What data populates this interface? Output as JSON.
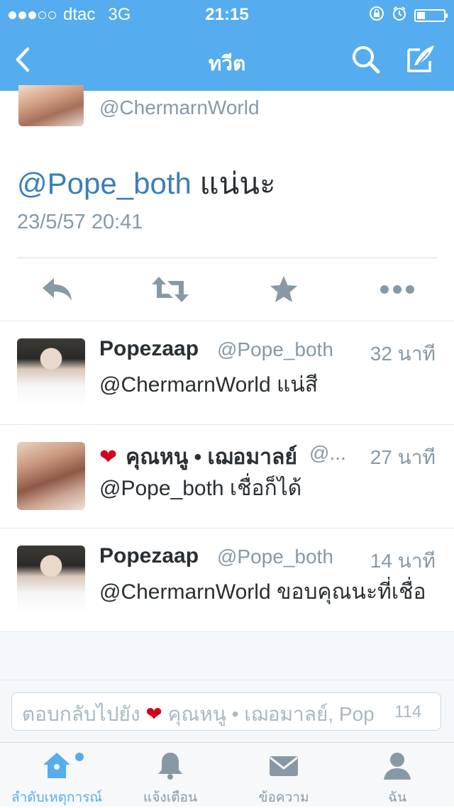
{
  "status_bar": {
    "signal_filled": 3,
    "signal_total": 5,
    "carrier": "dtac",
    "network": "3G",
    "time": "21:15",
    "battery_level": 0.3
  },
  "nav": {
    "title": "ทวีต",
    "icons": [
      "back-icon",
      "search-icon",
      "compose-icon"
    ]
  },
  "tweet": {
    "handle": "@ChermarnWorld",
    "mention": "@Pope_both",
    "text": "แน่นะ",
    "timestamp": "23/5/57 20:41",
    "actions": [
      "reply-icon",
      "retweet-icon",
      "favorite-icon",
      "more-icon"
    ]
  },
  "replies": [
    {
      "name": "Popezaap",
      "handle": "@Pope_both",
      "ago": "32 นาที",
      "text": "@ChermarnWorld แน่สี",
      "heart": false
    },
    {
      "name": "คุณหนู • เฌอมาลย์",
      "handle": "@...",
      "ago": "27 นาที",
      "text": "@Pope_both เชื่อก็ได้",
      "heart": true
    },
    {
      "name": "Popezaap",
      "handle": "@Pope_both",
      "ago": "14 นาที",
      "text": "@ChermarnWorld ขอบคุณนะที่เชื่อ",
      "heart": false
    }
  ],
  "composer": {
    "prefix": "ตอบกลับไปยัง",
    "recipients": "คุณหนู • เฌอมาลย์, Pop",
    "char_count": "114"
  },
  "tabs": [
    {
      "label": "ลำดับเหตุการณ์",
      "icon": "home-icon",
      "active": true
    },
    {
      "label": "แจ้งเตือน",
      "icon": "bell-icon",
      "active": false
    },
    {
      "label": "ข้อความ",
      "icon": "envelope-icon",
      "active": false
    },
    {
      "label": "ฉัน",
      "icon": "person-icon",
      "active": false
    }
  ],
  "colors": {
    "brand": "#55acee",
    "mention": "#3b7fb8",
    "heart": "#d0021b",
    "muted": "#8899a6",
    "text": "#292f33"
  }
}
